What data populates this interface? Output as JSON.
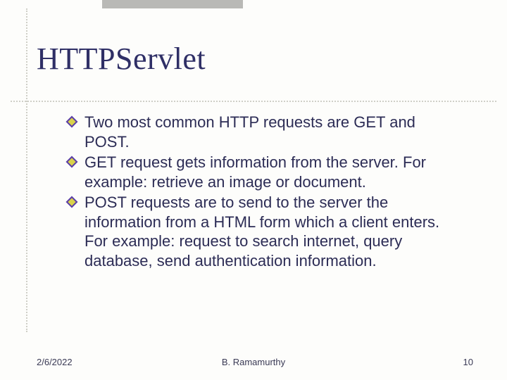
{
  "title": "HTTPServlet",
  "bullets": [
    "Two most common HTTP requests are GET and POST.",
    "GET request gets information from the server. For example: retrieve an image or document.",
    "POST requests are to send to the server the information from a HTML form which a client enters. For example: request to search internet, query database, send authentication information."
  ],
  "footer": {
    "date": "2/6/2022",
    "author": "B. Ramamurthy",
    "page": "10"
  }
}
